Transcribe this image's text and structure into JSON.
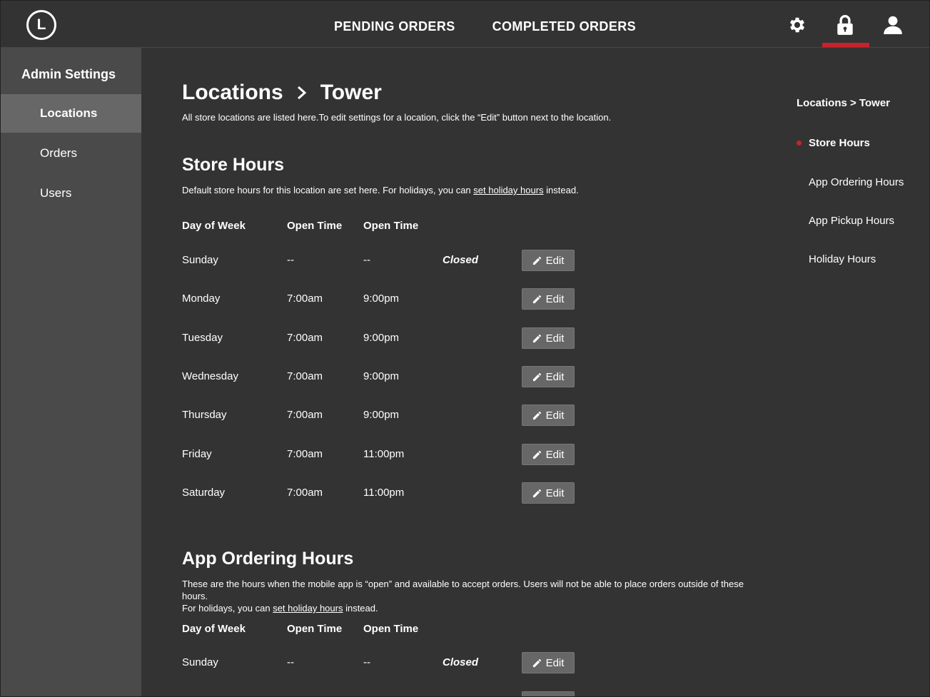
{
  "header": {
    "logo_letter": "L",
    "nav": [
      "PENDING ORDERS",
      "COMPLETED ORDERS"
    ],
    "icons": [
      "gear-icon",
      "lock-icon",
      "user-icon"
    ],
    "active_icon": "lock-icon",
    "accent_color": "#c8232c"
  },
  "sidebar": {
    "title": "Admin Settings",
    "items": [
      {
        "label": "Locations",
        "active": true
      },
      {
        "label": "Orders",
        "active": false
      },
      {
        "label": "Users",
        "active": false
      }
    ]
  },
  "main": {
    "breadcrumb": [
      "Locations",
      "Tower"
    ],
    "intro": "All store locations are listed here.To edit settings for a location, click the “Edit” button next to the location.",
    "store_hours": {
      "title": "Store Hours",
      "desc_before": "Default store hours for this location are set here. For holidays, you can ",
      "desc_link": "set holiday hours",
      "desc_after": " instead.",
      "columns": [
        "Day of Week",
        "Open Time",
        "Open Time"
      ],
      "rows": [
        {
          "day": "Sunday",
          "open": "--",
          "close": "--",
          "status": "Closed"
        },
        {
          "day": "Monday",
          "open": "7:00am",
          "close": "9:00pm",
          "status": ""
        },
        {
          "day": "Tuesday",
          "open": "7:00am",
          "close": "9:00pm",
          "status": ""
        },
        {
          "day": "Wednesday",
          "open": "7:00am",
          "close": "9:00pm",
          "status": ""
        },
        {
          "day": "Thursday",
          "open": "7:00am",
          "close": "9:00pm",
          "status": ""
        },
        {
          "day": "Friday",
          "open": "7:00am",
          "close": "11:00pm",
          "status": ""
        },
        {
          "day": "Saturday",
          "open": "7:00am",
          "close": "11:00pm",
          "status": ""
        }
      ],
      "edit_label": "Edit"
    },
    "app_ordering_hours": {
      "title": "App Ordering Hours",
      "desc_line1": "These are the hours when the mobile app is “open” and available to accept orders. Users will not be able to place orders outside of these hours.",
      "desc_before": "For holidays, you can ",
      "desc_link": "set holiday hours",
      "desc_after": " instead.",
      "columns": [
        "Day of Week",
        "Open Time",
        "Open Time"
      ],
      "rows": [
        {
          "day": "Sunday",
          "open": "--",
          "close": "--",
          "status": "Closed"
        }
      ],
      "edit_label": "Edit"
    }
  },
  "toc": {
    "heading": "Locations > Tower",
    "items": [
      {
        "label": "Store Hours",
        "active": true
      },
      {
        "label": "App Ordering Hours",
        "active": false
      },
      {
        "label": "App Pickup Hours",
        "active": false
      },
      {
        "label": "Holiday Hours",
        "active": false
      }
    ]
  }
}
